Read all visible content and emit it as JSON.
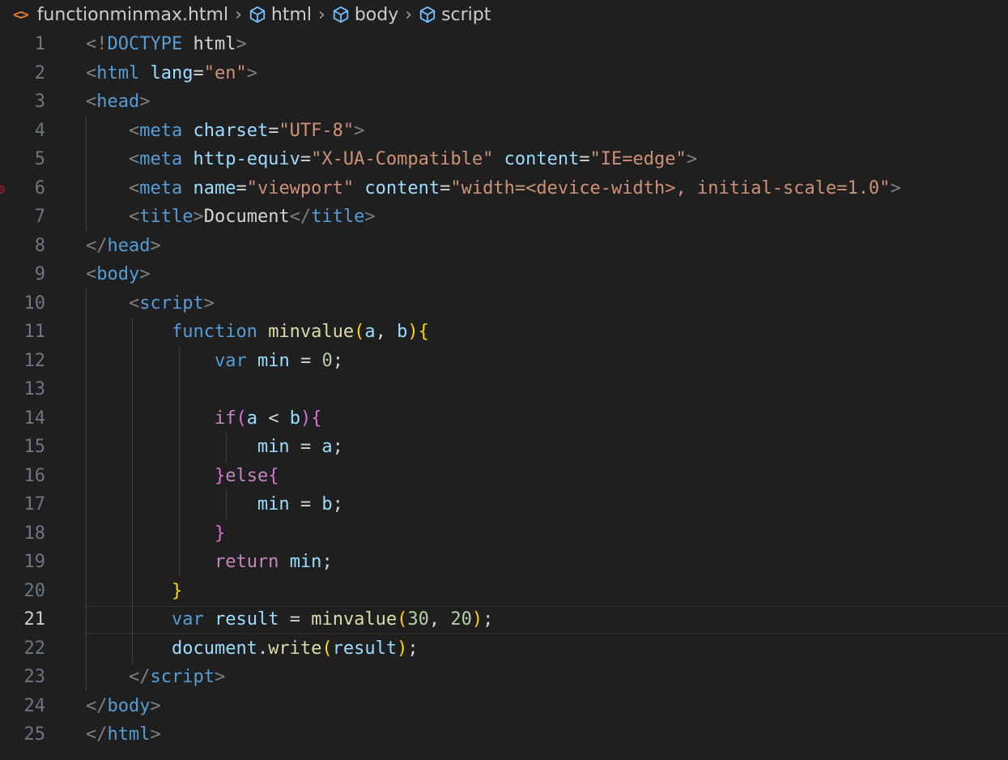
{
  "breadcrumb": {
    "file_icon": "<>",
    "file": "functionminmax.html",
    "items": [
      "html",
      "body",
      "script"
    ]
  },
  "current_line": 21,
  "lines": [
    {
      "n": "1",
      "tokens": [
        [
          "<!",
          "br"
        ],
        [
          "DOCTYPE",
          "doc"
        ],
        [
          " ",
          "plain"
        ],
        [
          "html",
          "html"
        ],
        [
          ">",
          "br"
        ]
      ]
    },
    {
      "n": "2",
      "tokens": [
        [
          "<",
          "br"
        ],
        [
          "html",
          "tag"
        ],
        [
          " ",
          "plain"
        ],
        [
          "lang",
          "attr"
        ],
        [
          "=",
          "eq"
        ],
        [
          "\"en\"",
          "str"
        ],
        [
          ">",
          "br"
        ]
      ]
    },
    {
      "n": "3",
      "tokens": [
        [
          "<",
          "br"
        ],
        [
          "head",
          "tag"
        ],
        [
          ">",
          "br"
        ]
      ]
    },
    {
      "n": "4",
      "tokens": [
        [
          "    ",
          "plain"
        ],
        [
          "<",
          "br"
        ],
        [
          "meta",
          "tag"
        ],
        [
          " ",
          "plain"
        ],
        [
          "charset",
          "attr"
        ],
        [
          "=",
          "eq"
        ],
        [
          "\"UTF-8\"",
          "str"
        ],
        [
          ">",
          "br"
        ]
      ]
    },
    {
      "n": "5",
      "tokens": [
        [
          "    ",
          "plain"
        ],
        [
          "<",
          "br"
        ],
        [
          "meta",
          "tag"
        ],
        [
          " ",
          "plain"
        ],
        [
          "http-equiv",
          "attr"
        ],
        [
          "=",
          "eq"
        ],
        [
          "\"X-UA-Compatible\"",
          "str"
        ],
        [
          " ",
          "plain"
        ],
        [
          "content",
          "attr"
        ],
        [
          "=",
          "eq"
        ],
        [
          "\"IE=edge\"",
          "str"
        ],
        [
          ">",
          "br"
        ]
      ]
    },
    {
      "n": "6",
      "tokens": [
        [
          "    ",
          "plain"
        ],
        [
          "<",
          "br"
        ],
        [
          "meta",
          "tag"
        ],
        [
          " ",
          "plain"
        ],
        [
          "name",
          "attr"
        ],
        [
          "=",
          "eq"
        ],
        [
          "\"viewport\"",
          "str"
        ],
        [
          " ",
          "plain"
        ],
        [
          "content",
          "attr"
        ],
        [
          "=",
          "eq"
        ],
        [
          "\"width=<device-width>, initial-scale=1.0\"",
          "str"
        ],
        [
          ">",
          "br"
        ]
      ]
    },
    {
      "n": "7",
      "tokens": [
        [
          "    ",
          "plain"
        ],
        [
          "<",
          "br"
        ],
        [
          "title",
          "tag"
        ],
        [
          ">",
          "br"
        ],
        [
          "Document",
          "plain"
        ],
        [
          "</",
          "br"
        ],
        [
          "title",
          "tag"
        ],
        [
          ">",
          "br"
        ]
      ]
    },
    {
      "n": "8",
      "tokens": [
        [
          "</",
          "br"
        ],
        [
          "head",
          "tag"
        ],
        [
          ">",
          "br"
        ]
      ]
    },
    {
      "n": "9",
      "tokens": [
        [
          "<",
          "br"
        ],
        [
          "body",
          "tag"
        ],
        [
          ">",
          "br"
        ]
      ]
    },
    {
      "n": "10",
      "tokens": [
        [
          "    ",
          "plain"
        ],
        [
          "<",
          "br"
        ],
        [
          "script",
          "tag"
        ],
        [
          ">",
          "br"
        ]
      ]
    },
    {
      "n": "11",
      "tokens": [
        [
          "        ",
          "plain"
        ],
        [
          "function",
          "kw"
        ],
        [
          " ",
          "plain"
        ],
        [
          "minvalue",
          "fn"
        ],
        [
          "(",
          "p1"
        ],
        [
          "a",
          "var"
        ],
        [
          ", ",
          "plain"
        ],
        [
          "b",
          "var"
        ],
        [
          ")",
          "p1"
        ],
        [
          "{",
          "p1"
        ]
      ]
    },
    {
      "n": "12",
      "tokens": [
        [
          "            ",
          "plain"
        ],
        [
          "var",
          "kw"
        ],
        [
          " ",
          "plain"
        ],
        [
          "min",
          "var"
        ],
        [
          " = ",
          "op"
        ],
        [
          "0",
          "num"
        ],
        [
          ";",
          "plain"
        ]
      ]
    },
    {
      "n": "13",
      "tokens": []
    },
    {
      "n": "14",
      "tokens": [
        [
          "            ",
          "plain"
        ],
        [
          "if",
          "ctl"
        ],
        [
          "(",
          "p2"
        ],
        [
          "a",
          "var"
        ],
        [
          " < ",
          "op"
        ],
        [
          "b",
          "var"
        ],
        [
          ")",
          "p2"
        ],
        [
          "{",
          "p2"
        ]
      ]
    },
    {
      "n": "15",
      "tokens": [
        [
          "                ",
          "plain"
        ],
        [
          "min",
          "var"
        ],
        [
          " = ",
          "op"
        ],
        [
          "a",
          "var"
        ],
        [
          ";",
          "plain"
        ]
      ]
    },
    {
      "n": "16",
      "tokens": [
        [
          "            ",
          "plain"
        ],
        [
          "}",
          "p2"
        ],
        [
          "else",
          "ctl"
        ],
        [
          "{",
          "p2"
        ]
      ]
    },
    {
      "n": "17",
      "tokens": [
        [
          "                ",
          "plain"
        ],
        [
          "min",
          "var"
        ],
        [
          " = ",
          "op"
        ],
        [
          "b",
          "var"
        ],
        [
          ";",
          "plain"
        ]
      ]
    },
    {
      "n": "18",
      "tokens": [
        [
          "            ",
          "plain"
        ],
        [
          "}",
          "p2"
        ]
      ]
    },
    {
      "n": "19",
      "tokens": [
        [
          "            ",
          "plain"
        ],
        [
          "return",
          "ctl"
        ],
        [
          " ",
          "plain"
        ],
        [
          "min",
          "var"
        ],
        [
          ";",
          "plain"
        ]
      ]
    },
    {
      "n": "20",
      "tokens": [
        [
          "        ",
          "plain"
        ],
        [
          "}",
          "p1"
        ]
      ]
    },
    {
      "n": "21",
      "tokens": [
        [
          "        ",
          "plain"
        ],
        [
          "var",
          "kw"
        ],
        [
          " ",
          "plain"
        ],
        [
          "result",
          "var"
        ],
        [
          " = ",
          "op"
        ],
        [
          "minvalue",
          "fn"
        ],
        [
          "(",
          "p1"
        ],
        [
          "30",
          "num"
        ],
        [
          ", ",
          "plain"
        ],
        [
          "20",
          "num"
        ],
        [
          ")",
          "p1"
        ],
        [
          ";",
          "plain"
        ]
      ]
    },
    {
      "n": "22",
      "tokens": [
        [
          "        ",
          "plain"
        ],
        [
          "document",
          "var"
        ],
        [
          ".",
          "plain"
        ],
        [
          "write",
          "fn"
        ],
        [
          "(",
          "p1"
        ],
        [
          "result",
          "var"
        ],
        [
          ")",
          "p1"
        ],
        [
          ";",
          "plain"
        ]
      ]
    },
    {
      "n": "23",
      "tokens": [
        [
          "    ",
          "plain"
        ],
        [
          "</",
          "br"
        ],
        [
          "script",
          "tag"
        ],
        [
          ">",
          "br"
        ]
      ]
    },
    {
      "n": "24",
      "tokens": [
        [
          "</",
          "br"
        ],
        [
          "body",
          "tag"
        ],
        [
          ">",
          "br"
        ]
      ]
    },
    {
      "n": "25",
      "tokens": [
        [
          "</",
          "br"
        ],
        [
          "html",
          "tag"
        ],
        [
          ">",
          "br"
        ]
      ]
    }
  ]
}
